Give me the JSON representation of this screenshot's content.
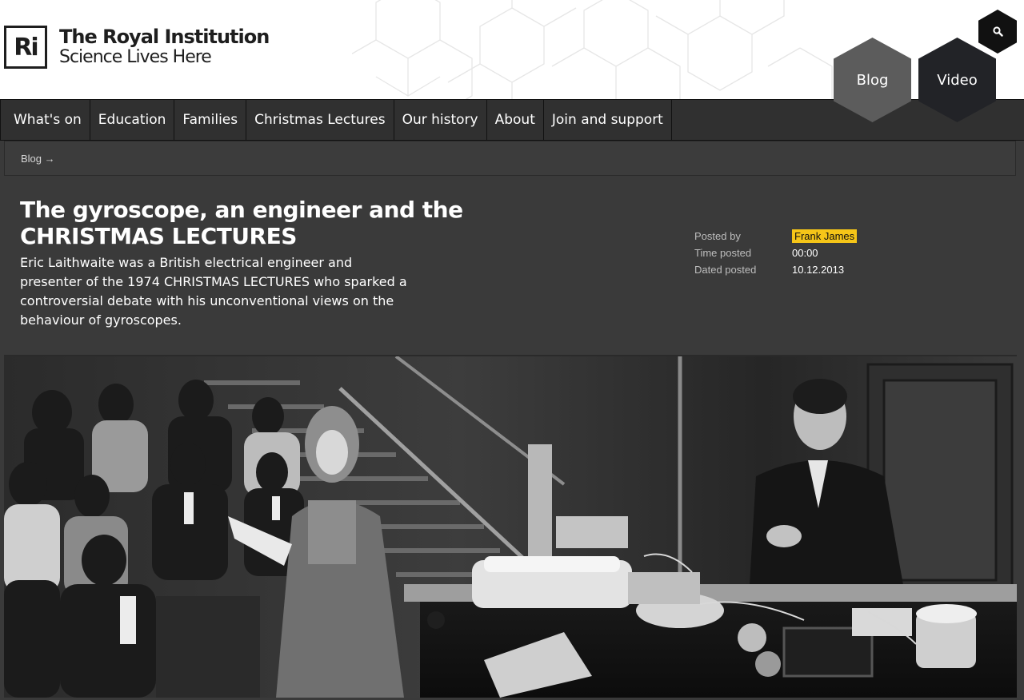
{
  "brand": {
    "logo_mark": "Ri",
    "name": "The Royal Institution",
    "tagline": "Science Lives Here"
  },
  "header_buttons": {
    "blog": "Blog",
    "video": "Video",
    "search_icon": "search-icon"
  },
  "nav": {
    "items": [
      "What's on",
      "Education",
      "Families",
      "Christmas Lectures",
      "Our history",
      "About",
      "Join and support"
    ]
  },
  "breadcrumb": {
    "label": "Blog →"
  },
  "article": {
    "title_line1": "The gyroscope, an engineer and the",
    "title_line2": "CHRISTMAS LECTURES",
    "summary": "Eric Laithwaite was a British electrical engineer and presenter of the 1974 CHRISTMAS LECTURES who sparked a controversial debate with his unconventional views on the behaviour of gyroscopes."
  },
  "meta": {
    "posted_by_label": "Posted by",
    "posted_by": "Frank James",
    "time_label": "Time posted",
    "time": "00:00",
    "date_label": "Dated posted",
    "date": "10.12.2013"
  },
  "colors": {
    "accent_yellow": "#f5c518",
    "dark_bg": "#3a3a3a",
    "nav_bg": "#303030",
    "blog_hex": "#5c5c5c",
    "video_hex": "#222327"
  }
}
